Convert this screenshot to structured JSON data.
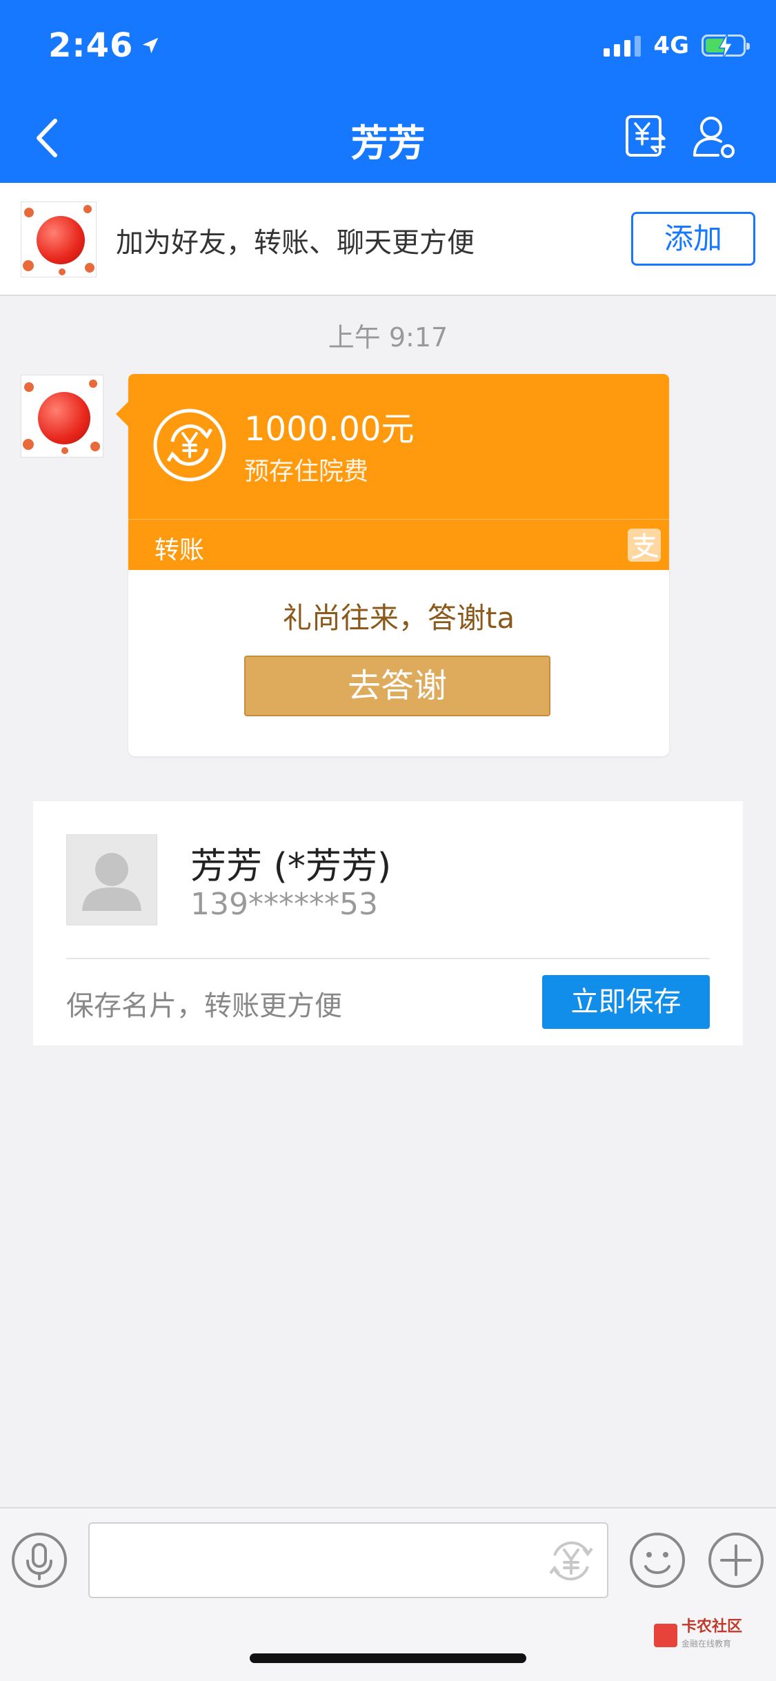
{
  "status_bar": {
    "time": "2:46",
    "network": "4G"
  },
  "nav": {
    "title": "芳芳"
  },
  "add_banner": {
    "text": "加为好友，转账、聊天更方便",
    "button": "添加"
  },
  "chat": {
    "timestamp": "上午 9:17",
    "transfer_card": {
      "amount": "1000.00元",
      "note": "预存住院费",
      "type_label": "转账",
      "thanks_text": "礼尚往来，答谢ta",
      "thanks_button": "去答谢"
    }
  },
  "contact_card": {
    "name": "芳芳 (*芳芳)",
    "phone": "139******53",
    "hint": "保存名片，转账更方便",
    "save_button": "立即保存"
  },
  "input_bar": {
    "placeholder": ""
  },
  "watermark": {
    "title": "卡农社区",
    "subtitle": "金融在线教育"
  },
  "colors": {
    "header": "#1677ff",
    "transfer_card": "#ff9a0e",
    "thanks_button": "#deaa5c",
    "save_button": "#108ee9"
  }
}
